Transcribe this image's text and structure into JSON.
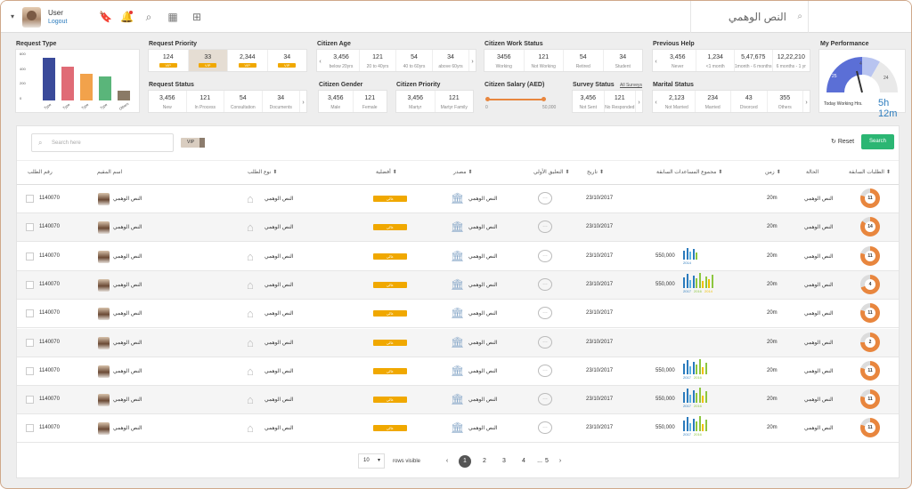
{
  "header": {
    "user_name": "User",
    "logout": "Logout",
    "search_value": "النص الوهمي"
  },
  "widgets": {
    "request_type": {
      "title": "Request Type",
      "y_ticks": [
        "600",
        "400",
        "200",
        "0"
      ],
      "bars": [
        {
          "label": "Type",
          "value": 580,
          "color": "#3a4a9a"
        },
        {
          "label": "Type",
          "value": 460,
          "color": "#e06b76"
        },
        {
          "label": "Type",
          "value": 360,
          "color": "#f2a24b"
        },
        {
          "label": "Type",
          "value": 320,
          "color": "#5ab57a"
        },
        {
          "label": "Others",
          "value": 130,
          "color": "#8a7a66"
        }
      ]
    },
    "request_priority": {
      "title": "Request Priority",
      "cells": [
        {
          "v": "124",
          "s": "VIP"
        },
        {
          "v": "33",
          "s": "VIP"
        },
        {
          "v": "2,344",
          "s": "VIP"
        },
        {
          "v": "34",
          "s": "VIP"
        }
      ]
    },
    "citizen_age": {
      "title": "Citizen Age",
      "cells": [
        {
          "v": "3,456",
          "s": "below 20yrs"
        },
        {
          "v": "121",
          "s": "20 to 40yrs"
        },
        {
          "v": "54",
          "s": "40 to 60yrs"
        },
        {
          "v": "34",
          "s": "above 60yrs"
        }
      ]
    },
    "work_status": {
      "title": "Citizen Work Status",
      "cells": [
        {
          "v": "3456",
          "s": "Working"
        },
        {
          "v": "121",
          "s": "Not Working"
        },
        {
          "v": "54",
          "s": "Retired"
        },
        {
          "v": "34",
          "s": "Student"
        }
      ]
    },
    "previous_help": {
      "title": "Previous Help",
      "cells": [
        {
          "v": "3,456",
          "s": "Never"
        },
        {
          "v": "1,234",
          "s": "<1 month"
        },
        {
          "v": "5,47,675",
          "s": "1month - 6 months"
        },
        {
          "v": "12,22,210",
          "s": "6 months - 1 yr"
        }
      ]
    },
    "performance": {
      "title": "My Performance",
      "gauge": [
        "25",
        "4",
        "24"
      ],
      "label": "Today Working Hrs.",
      "value": "5h 12m"
    },
    "request_status": {
      "title": "Request Status",
      "cells": [
        {
          "v": "3,456",
          "s": "New"
        },
        {
          "v": "121",
          "s": "In Process"
        },
        {
          "v": "54",
          "s": "Consultation"
        },
        {
          "v": "34",
          "s": "Documents"
        }
      ]
    },
    "gender": {
      "title": "Citizen Gender",
      "cells": [
        {
          "v": "3,456",
          "s": "Male"
        },
        {
          "v": "121",
          "s": "Female"
        }
      ]
    },
    "citizen_priority": {
      "title": "Citizen Priority",
      "cells": [
        {
          "v": "3,456",
          "s": "Martyr"
        },
        {
          "v": "121",
          "s": "Martyr Family"
        }
      ]
    },
    "salary": {
      "title": "Citizen Salary (AED)",
      "min": "0",
      "max": "50,000"
    },
    "survey": {
      "title": "Survey Status",
      "link": "All Surveys",
      "cells": [
        {
          "v": "3,456",
          "s": "Not Sent"
        },
        {
          "v": "121",
          "s": "No Responded"
        }
      ]
    },
    "marital": {
      "title": "Marital Status",
      "cells": [
        {
          "v": "2,123",
          "s": "Not Married"
        },
        {
          "v": "234",
          "s": "Married"
        },
        {
          "v": "43",
          "s": "Divorced"
        },
        {
          "v": "355",
          "s": "Others"
        }
      ]
    }
  },
  "table": {
    "search_placeholder": "Search here",
    "vip": "VIP",
    "reset": "Reset",
    "search": "Search",
    "columns": {
      "id": "رقم الطلب",
      "name": "اسم المقيم",
      "type": "نوع الطلب",
      "priority": "أفضلية",
      "source": "مصدر",
      "comment": "التعليق الأولي",
      "date": "تاريخ",
      "help_total": "مجموع المساعدات السابقة",
      "time": "زمن",
      "status": "الحالة",
      "previous": "الطلبات السابقة"
    },
    "rows": [
      {
        "id": "1140070",
        "name": "النص الوهمي",
        "type": "النص الوهمي",
        "priority": "عالي",
        "source": "النص الوهمي",
        "date": "23/10/2017",
        "amount": "",
        "spark": "",
        "time": "20m",
        "status": "النص الوهمي",
        "prev": "11",
        "pct": 0.8
      },
      {
        "id": "1140070",
        "name": "النص الوهمي",
        "type": "النص الوهمي",
        "priority": "عالي",
        "source": "النص الوهمي",
        "date": "23/10/2017",
        "amount": "",
        "spark": "",
        "time": "20m",
        "status": "النص الوهمي",
        "prev": "14",
        "pct": 0.85
      },
      {
        "id": "1140070",
        "name": "النص الوهمي",
        "type": "النص الوهمي",
        "priority": "عالي",
        "source": "النص الوهمي",
        "date": "23/10/2017",
        "amount": "550,000",
        "spark": "one",
        "time": "20m",
        "status": "النص الوهمي",
        "prev": "11",
        "pct": 0.8
      },
      {
        "id": "1140070",
        "name": "النص الوهمي",
        "type": "النص الوهمي",
        "priority": "عالي",
        "source": "النص الوهمي",
        "date": "23/10/2017",
        "amount": "550,000",
        "spark": "three",
        "time": "20m",
        "status": "النص الوهمي",
        "prev": "4",
        "pct": 0.7
      },
      {
        "id": "1140070",
        "name": "النص الوهمي",
        "type": "النص الوهمي",
        "priority": "عالي",
        "source": "النص الوهمي",
        "date": "23/10/2017",
        "amount": "",
        "spark": "",
        "time": "20m",
        "status": "النص الوهمي",
        "prev": "11",
        "pct": 0.8
      },
      {
        "id": "1140070",
        "name": "النص الوهمي",
        "type": "النص الوهمي",
        "priority": "عالي",
        "source": "النص الوهمي",
        "date": "23/10/2017",
        "amount": "",
        "spark": "",
        "time": "20m",
        "status": "النص الوهمي",
        "prev": "2",
        "pct": 0.75
      },
      {
        "id": "1140070",
        "name": "النص الوهمي",
        "type": "النص الوهمي",
        "priority": "عالي",
        "source": "النص الوهمي",
        "date": "23/10/2017",
        "amount": "550,000",
        "spark": "two",
        "time": "20m",
        "status": "النص الوهمي",
        "prev": "11",
        "pct": 0.8
      },
      {
        "id": "1140070",
        "name": "النص الوهمي",
        "type": "النص الوهمي",
        "priority": "عالي",
        "source": "النص الوهمي",
        "date": "23/10/2017",
        "amount": "550,000",
        "spark": "two",
        "time": "20m",
        "status": "النص الوهمي",
        "prev": "11",
        "pct": 0.8
      },
      {
        "id": "1140070",
        "name": "النص الوهمي",
        "type": "النص الوهمي",
        "priority": "عالي",
        "source": "النص الوهمي",
        "date": "23/10/2017",
        "amount": "550,000",
        "spark": "two",
        "time": "20m",
        "status": "النص الوهمي",
        "prev": "11",
        "pct": 0.8
      }
    ],
    "spark_years": {
      "one": [
        "2014"
      ],
      "two": [
        "2017",
        "2016"
      ],
      "three": [
        "2017",
        "2016",
        "2014"
      ]
    },
    "pagination": {
      "rows": "10",
      "rows_label": "rows visible",
      "pages": [
        "1",
        "2",
        "3",
        "4",
        "...",
        "5"
      ],
      "active": "1"
    }
  }
}
